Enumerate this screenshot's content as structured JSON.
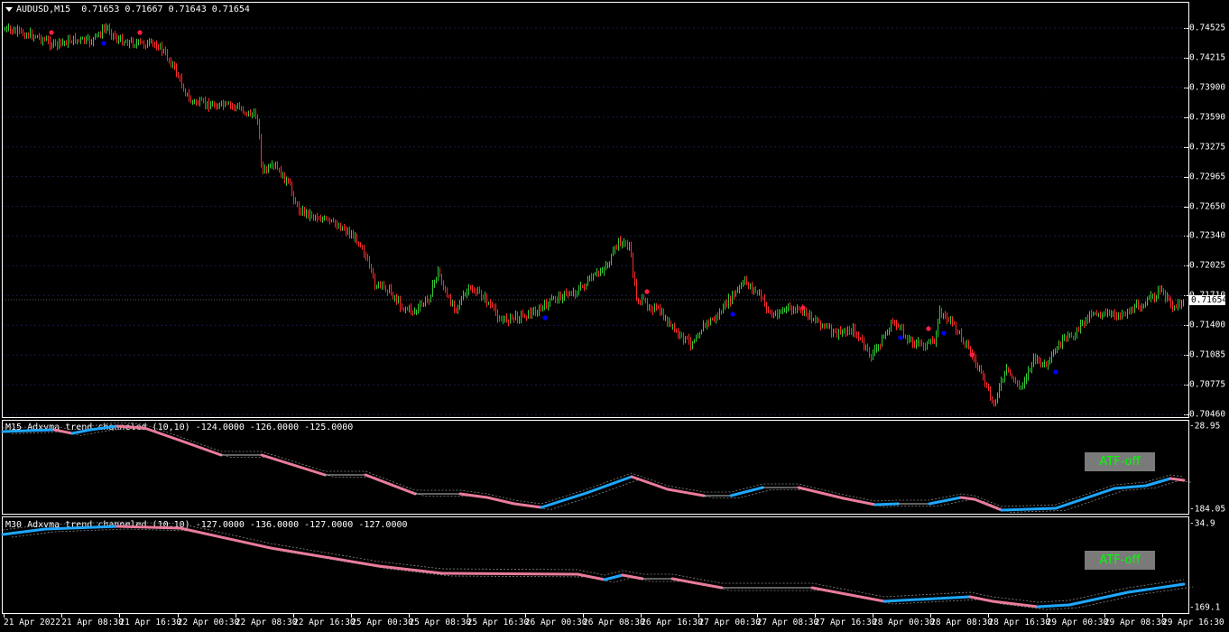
{
  "main": {
    "symbol": "AUDUSD,M15",
    "ohlc": "0.71653 0.71667 0.71643 0.71654",
    "current_price": "0.71654",
    "price_labels": [
      "0.74525",
      "0.74215",
      "0.73900",
      "0.73590",
      "0.73275",
      "0.72965",
      "0.72650",
      "0.72340",
      "0.72025",
      "0.71710",
      "0.71400",
      "0.71085",
      "0.70775",
      "0.70460"
    ],
    "colors": {
      "bull": "#32cd32",
      "bear": "#ff2a2a",
      "dot_up": "#0000ff",
      "dot_down": "#ff2040"
    }
  },
  "indicator1": {
    "title": "M15 Adxvma trend channeled (10,10) -124.0000 -126.0000 -125.0000",
    "scale_top": "-28.95",
    "scale_bottom": "-184.05",
    "button": "ATF-off",
    "colors": {
      "up": "#1ea7ff",
      "down": "#e97b9b",
      "flat": "#c0c0c0"
    }
  },
  "indicator2": {
    "title": "M30 Adxvma trend channeled (10,10) -127.0000 -136.0000 -127.0000 -127.0000",
    "scale_top": "-34.9",
    "scale_bottom": "-169.1",
    "button": "ATF-off"
  },
  "time_labels": [
    "21 Apr 2022",
    "21 Apr 08:30",
    "21 Apr 16:30",
    "22 Apr 00:30",
    "22 Apr 08:30",
    "22 Apr 16:30",
    "25 Apr 00:30",
    "25 Apr 08:30",
    "25 Apr 16:30",
    "26 Apr 00:30",
    "26 Apr 08:30",
    "26 Apr 16:30",
    "27 Apr 00:30",
    "27 Apr 08:30",
    "27 Apr 16:30",
    "28 Apr 00:30",
    "28 Apr 08:30",
    "28 Apr 16:30",
    "29 Apr 00:30",
    "29 Apr 08:30",
    "29 Apr 16:30"
  ],
  "chart_data": {
    "type": "candlestick",
    "description_values": "approximate close path of AUDUSD M15",
    "x": [
      "21 Apr 2022",
      "21 Apr 08:30",
      "21 Apr 16:30",
      "22 Apr 00:30",
      "22 Apr 08:30",
      "22 Apr 16:30",
      "25 Apr 00:30",
      "25 Apr 08:30",
      "25 Apr 16:30",
      "26 Apr 00:30",
      "26 Apr 08:30",
      "26 Apr 16:30",
      "27 Apr 00:30",
      "27 Apr 08:30",
      "27 Apr 16:30",
      "28 Apr 00:30",
      "28 Apr 08:30",
      "28 Apr 16:30",
      "29 Apr 00:30",
      "29 Apr 08:30",
      "29 Apr 16:30"
    ],
    "close": [
      0.7448,
      0.7441,
      0.7446,
      0.7382,
      0.737,
      0.727,
      0.7172,
      0.7178,
      0.7148,
      0.716,
      0.721,
      0.7135,
      0.7152,
      0.716,
      0.714,
      0.7122,
      0.7125,
      0.7055,
      0.711,
      0.7158,
      0.7166
    ],
    "ylim": [
      0.7046,
      0.74525
    ]
  }
}
